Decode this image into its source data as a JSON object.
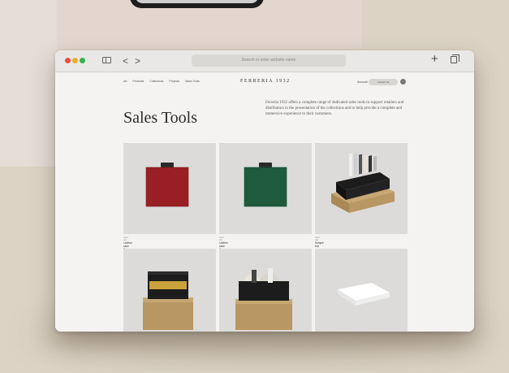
{
  "browser": {
    "address_text": "Search or enter website name"
  },
  "site": {
    "nav": [
      "Art",
      "Products",
      "Collections",
      "Projects",
      "Sales Tools"
    ],
    "brand": "FERRERIA 1932",
    "brand_sub": "",
    "header_link": "Account",
    "header_button": "Contact Us"
  },
  "main": {
    "title": "Sales Tools",
    "description": "Ferreria 1932 offers a complete range of dedicated sales tools to support retailers and distributors in the presentation of the collections and to help provide a complete and immersive experience to their customers."
  },
  "products": [
    {
      "category": "Sales tool",
      "name": "Leather case Red",
      "color": "#9a1f24",
      "kind": "case"
    },
    {
      "category": "Sales tool",
      "name": "Leather case Green",
      "color": "#1d5b3c",
      "kind": "case"
    },
    {
      "category": "Sales tool",
      "name": "Sample box",
      "color": "#1c1c1c",
      "kind": "box"
    },
    {
      "category": "",
      "name": "",
      "color": "#1c1c1c",
      "kind": "box2"
    },
    {
      "category": "",
      "name": "",
      "color": "#1c1c1c",
      "kind": "box3"
    },
    {
      "category": "",
      "name": "",
      "color": "#ffffff",
      "kind": "white"
    }
  ]
}
